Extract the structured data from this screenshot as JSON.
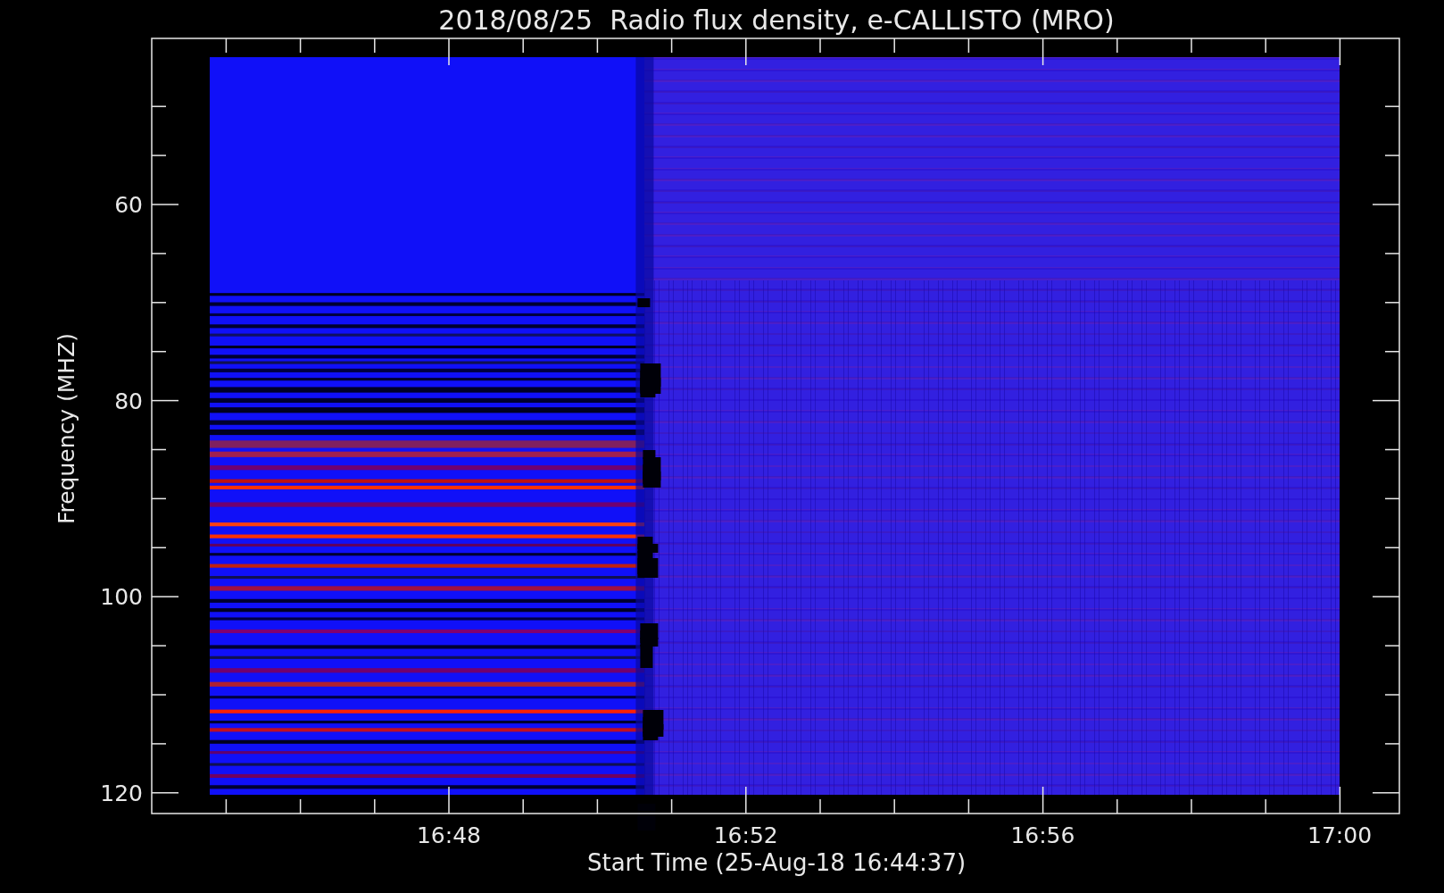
{
  "title": "2018/08/25  Radio flux density, e-CALLISTO (MRO)",
  "y_axis": {
    "label": "Frequency (MHZ)",
    "ticks": [
      "60",
      "80",
      "100",
      "120"
    ]
  },
  "x_axis": {
    "label": "Start Time (25-Aug-18 16:44:37)",
    "ticks": [
      "16:48",
      "16:52",
      "16:56",
      "17:00"
    ]
  }
}
